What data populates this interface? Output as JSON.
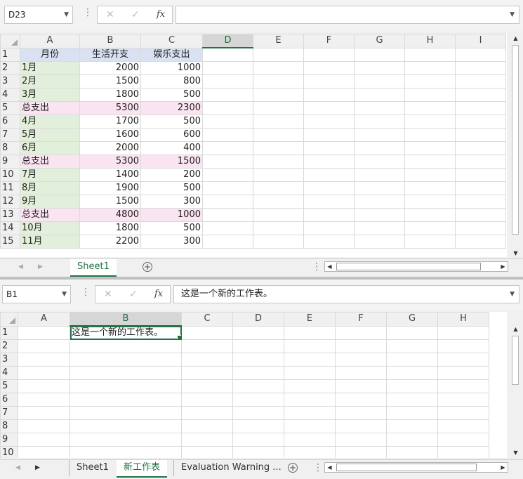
{
  "top": {
    "namebox": "D23",
    "formula": "",
    "columns": [
      "A",
      "B",
      "C",
      "D",
      "E",
      "F",
      "G",
      "H",
      "I"
    ],
    "selected_column": "D",
    "rows": [
      {
        "n": "1",
        "a": "月份",
        "b": "生活开支",
        "c": "娱乐支出",
        "kind": "hdr"
      },
      {
        "n": "2",
        "a": "1月",
        "b": "2000",
        "c": "1000",
        "kind": "m"
      },
      {
        "n": "3",
        "a": "2月",
        "b": "1500",
        "c": "800",
        "kind": "m"
      },
      {
        "n": "4",
        "a": "3月",
        "b": "1800",
        "c": "500",
        "kind": "m"
      },
      {
        "n": "5",
        "a": "总支出",
        "b": "5300",
        "c": "2300",
        "kind": "t"
      },
      {
        "n": "6",
        "a": "4月",
        "b": "1700",
        "c": "500",
        "kind": "m"
      },
      {
        "n": "7",
        "a": "5月",
        "b": "1600",
        "c": "600",
        "kind": "m"
      },
      {
        "n": "8",
        "a": "6月",
        "b": "2000",
        "c": "400",
        "kind": "m"
      },
      {
        "n": "9",
        "a": "总支出",
        "b": "5300",
        "c": "1500",
        "kind": "t"
      },
      {
        "n": "10",
        "a": "7月",
        "b": "1400",
        "c": "200",
        "kind": "m"
      },
      {
        "n": "11",
        "a": "8月",
        "b": "1900",
        "c": "500",
        "kind": "m"
      },
      {
        "n": "12",
        "a": "9月",
        "b": "1500",
        "c": "300",
        "kind": "m"
      },
      {
        "n": "13",
        "a": "总支出",
        "b": "4800",
        "c": "1000",
        "kind": "t"
      },
      {
        "n": "14",
        "a": "10月",
        "b": "1800",
        "c": "500",
        "kind": "m"
      },
      {
        "n": "15",
        "a": "11月",
        "b": "2200",
        "c": "300",
        "kind": "m"
      }
    ],
    "tabs": [
      "Sheet1"
    ],
    "active_tab": 0
  },
  "bottom": {
    "namebox": "B1",
    "formula": "这是一个新的工作表。",
    "columns": [
      "A",
      "B",
      "C",
      "D",
      "E",
      "F",
      "G",
      "H"
    ],
    "selected_column": "B",
    "rows": [
      "1",
      "2",
      "3",
      "4",
      "5",
      "6",
      "7",
      "8",
      "9",
      "10"
    ],
    "b1_value": "这是一个新的工作表。",
    "tabs": [
      "Sheet1",
      "新工作表",
      "Evaluation Warning ..."
    ],
    "active_tab": 1
  },
  "icons": {
    "cancel": "✕",
    "enter": "✓",
    "fx": "fx",
    "dropdown": "▼",
    "add_sheet": "+",
    "scroll_up": "▲",
    "scroll_down": "▼",
    "scroll_left": "◀",
    "scroll_right": "▶",
    "dots": "⋮"
  }
}
